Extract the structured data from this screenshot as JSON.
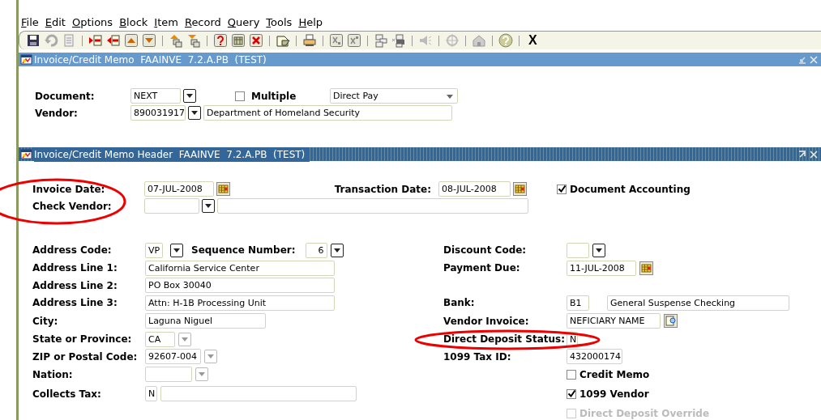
{
  "menu": [
    {
      "label": "File"
    },
    {
      "label": "Edit"
    },
    {
      "label": "Options"
    },
    {
      "label": "Block"
    },
    {
      "label": "Item"
    },
    {
      "label": "Record"
    },
    {
      "label": "Query"
    },
    {
      "label": "Tools"
    },
    {
      "label": "Help"
    }
  ],
  "toolbar": {
    "exit_label": "X"
  },
  "main_window": {
    "title": "Invoice/Credit Memo  FAAINVE  7.2.A.PB  (TEST)",
    "document": {
      "label": "Document:",
      "value": "NEXT"
    },
    "multiple": {
      "label": "Multiple",
      "checked": false
    },
    "pay_type": {
      "value": "Direct Pay"
    },
    "vendor": {
      "label": "Vendor:",
      "id": "890031917",
      "name": "Department of Homeland Security"
    }
  },
  "header_window": {
    "title": "Invoice/Credit Memo Header  FAAINVE  7.2.A.PB  (TEST)",
    "invoice_date": {
      "label": "Invoice Date:",
      "value": "07-JUL-2008"
    },
    "transaction_date": {
      "label": "Transaction Date:",
      "value": "08-JUL-2008"
    },
    "document_accounting": {
      "label": "Document Accounting",
      "checked": true
    },
    "check_vendor": {
      "label": "Check Vendor:"
    },
    "address_code": {
      "label": "Address Code:",
      "value": "VP"
    },
    "sequence_number": {
      "label": "Sequence Number:",
      "value": "6"
    },
    "address_lines": [
      {
        "label": "Address Line 1:",
        "value": "California Service Center"
      },
      {
        "label": "Address Line 2:",
        "value": "PO Box 30040"
      },
      {
        "label": "Address Line 3:",
        "value": "Attn: H-1B Processing Unit"
      }
    ],
    "city": {
      "label": "City:",
      "value": "Laguna Niguel"
    },
    "state": {
      "label": "State or Province:",
      "value": "CA",
      "list_disabled": true
    },
    "zip": {
      "label": "ZIP or Postal Code:",
      "value": "92607-004",
      "list_disabled": true
    },
    "nation": {
      "label": "Nation:",
      "list_disabled": true
    },
    "collects_tax": {
      "label": "Collects Tax:",
      "value": "N"
    },
    "discount_code": {
      "label": "Discount Code:"
    },
    "payment_due": {
      "label": "Payment Due:",
      "value": "11-JUL-2008"
    },
    "bank": {
      "label": "Bank:",
      "code": "B1",
      "name": "General Suspense Checking"
    },
    "vendor_invoice": {
      "label": "Vendor Invoice:",
      "value": "NEFICIARY NAME"
    },
    "direct_deposit_status": {
      "label": "Direct Deposit Status:",
      "value": "N"
    },
    "tax_id": {
      "label": "1099 Tax ID:",
      "value": "432000174"
    },
    "checkboxes": [
      {
        "label": "Credit Memo",
        "checked": false,
        "disabled": false
      },
      {
        "label": "1099 Vendor",
        "checked": true,
        "disabled": false
      },
      {
        "label": "Direct Deposit Override",
        "checked": false,
        "disabled": true
      }
    ]
  }
}
